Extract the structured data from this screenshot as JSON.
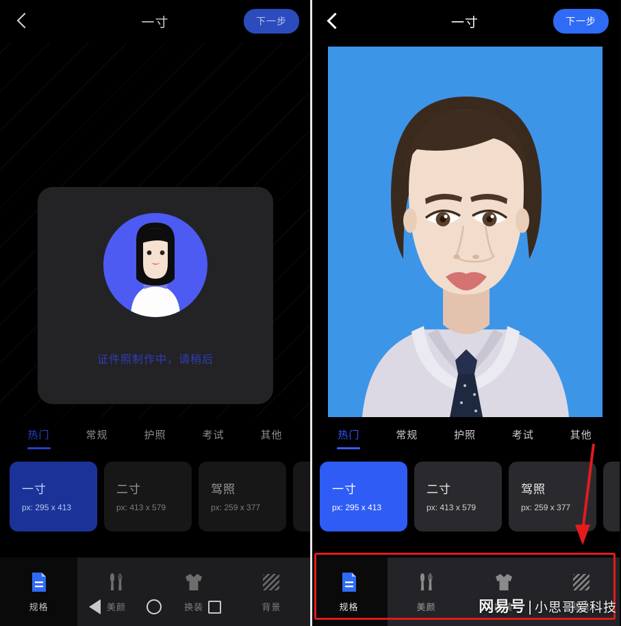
{
  "app": {
    "header": {
      "title": "一寸",
      "back_icon": "chevron-left-icon",
      "next_label": "下一步"
    },
    "left_panel": {
      "loading_text": "证件照制作中，请稍后",
      "avatar_icon": "user-avatar-illustration"
    },
    "right_panel": {
      "photo_alt": "id-photo-preview",
      "photo_background_color": "#3d95e8"
    },
    "tabs": [
      {
        "label": "热门",
        "active": true
      },
      {
        "label": "常规",
        "active": false
      },
      {
        "label": "护照",
        "active": false
      },
      {
        "label": "考试",
        "active": false
      },
      {
        "label": "其他",
        "active": false
      }
    ],
    "size_cards": [
      {
        "name": "一寸",
        "px": "px: 295 x 413",
        "selected": true
      },
      {
        "name": "二寸",
        "px": "px: 413 x 579",
        "selected": false
      },
      {
        "name": "驾照",
        "px": "px: 259 x 377",
        "selected": false
      }
    ],
    "toolbar": [
      {
        "label": "规格",
        "icon": "document-spec-icon",
        "active": true
      },
      {
        "label": "美颜",
        "icon": "beauty-brush-icon",
        "active": false
      },
      {
        "label": "换装",
        "icon": "tshirt-icon",
        "active": false
      },
      {
        "label": "背景",
        "icon": "background-hatch-icon",
        "active": false
      }
    ],
    "navbar": {
      "back_icon": "nav-back-triangle-icon",
      "home_icon": "nav-home-circle-icon",
      "recents_icon": "nav-recents-square-icon"
    },
    "annotations": {
      "arrow_color": "#e31b1b",
      "box_color": "#e31b1b"
    },
    "watermark": {
      "brand": "网易号",
      "separator": "|",
      "author": "小思哥爱科技"
    },
    "colors": {
      "accent_blue": "#2f5cf5",
      "dark_bg": "#000000",
      "card_bg": "#2a2a2e"
    }
  }
}
